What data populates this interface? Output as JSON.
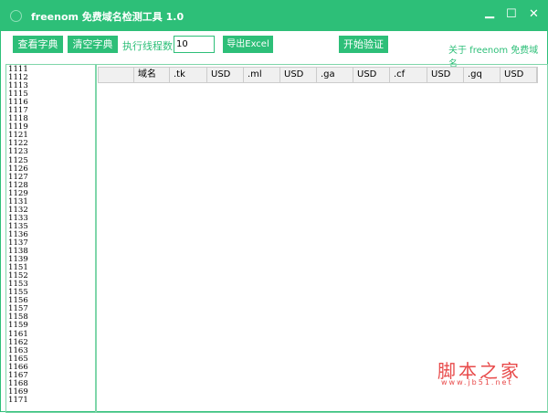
{
  "window": {
    "title": "freenom 免费域名检测工具 1.0",
    "minimize": "▁",
    "maximize": "☐",
    "close": "✕"
  },
  "toolbar": {
    "view_dict": "查看字典",
    "clear_dict": "清空字典",
    "threads_label": "执行线程数:",
    "threads_value": "10",
    "export": "导出Excel",
    "start": "开始验证",
    "about": "关于 freenom 免费域名"
  },
  "list": [
    "1111",
    "1112",
    "1113",
    "1115",
    "1116",
    "1117",
    "1118",
    "1119",
    "1121",
    "1122",
    "1123",
    "1125",
    "1126",
    "1127",
    "1128",
    "1129",
    "1131",
    "1132",
    "1133",
    "1135",
    "1136",
    "1137",
    "1138",
    "1139",
    "1151",
    "1152",
    "1153",
    "1155",
    "1156",
    "1157",
    "1158",
    "1159",
    "1161",
    "1162",
    "1163",
    "1165",
    "1166",
    "1167",
    "1168",
    "1169",
    "1171"
  ],
  "table": {
    "columns": [
      "",
      "域名",
      ".tk",
      "USD",
      ".ml",
      "USD",
      ".ga",
      "USD",
      ".cf",
      "USD",
      ".gq",
      "USD"
    ]
  },
  "watermark": {
    "text": "脚本之家",
    "url": "www.jb51.net"
  }
}
